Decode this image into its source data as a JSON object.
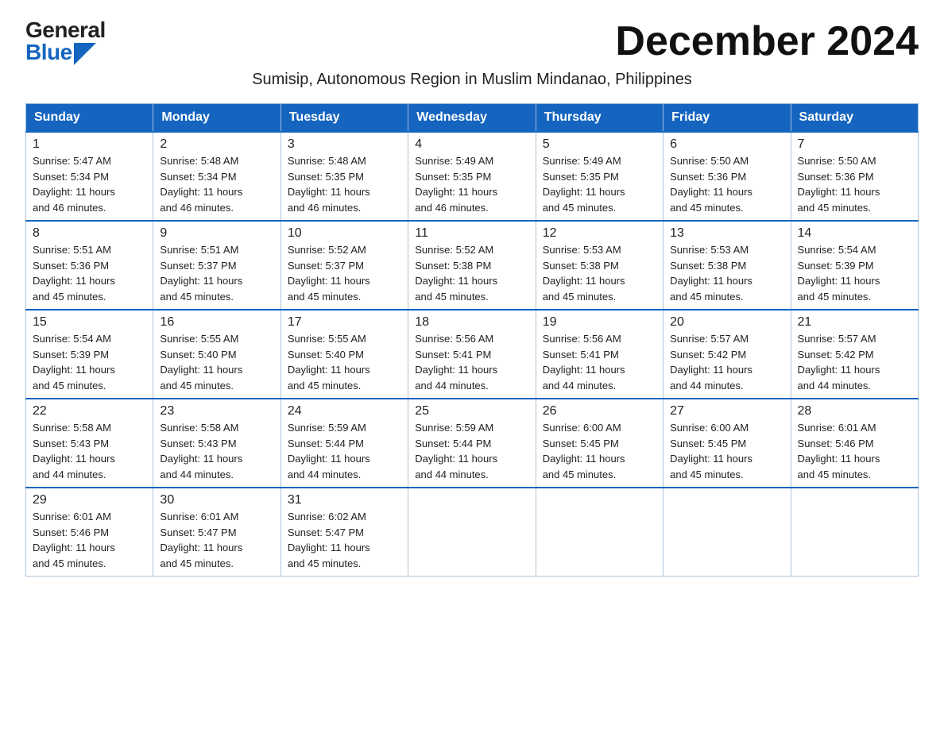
{
  "logo": {
    "general": "General",
    "blue": "Blue"
  },
  "title": "December 2024",
  "subtitle": "Sumisip, Autonomous Region in Muslim Mindanao, Philippines",
  "weekdays": [
    "Sunday",
    "Monday",
    "Tuesday",
    "Wednesday",
    "Thursday",
    "Friday",
    "Saturday"
  ],
  "weeks": [
    [
      {
        "day": "1",
        "sunrise": "5:47 AM",
        "sunset": "5:34 PM",
        "daylight": "11 hours and 46 minutes."
      },
      {
        "day": "2",
        "sunrise": "5:48 AM",
        "sunset": "5:34 PM",
        "daylight": "11 hours and 46 minutes."
      },
      {
        "day": "3",
        "sunrise": "5:48 AM",
        "sunset": "5:35 PM",
        "daylight": "11 hours and 46 minutes."
      },
      {
        "day": "4",
        "sunrise": "5:49 AM",
        "sunset": "5:35 PM",
        "daylight": "11 hours and 46 minutes."
      },
      {
        "day": "5",
        "sunrise": "5:49 AM",
        "sunset": "5:35 PM",
        "daylight": "11 hours and 45 minutes."
      },
      {
        "day": "6",
        "sunrise": "5:50 AM",
        "sunset": "5:36 PM",
        "daylight": "11 hours and 45 minutes."
      },
      {
        "day": "7",
        "sunrise": "5:50 AM",
        "sunset": "5:36 PM",
        "daylight": "11 hours and 45 minutes."
      }
    ],
    [
      {
        "day": "8",
        "sunrise": "5:51 AM",
        "sunset": "5:36 PM",
        "daylight": "11 hours and 45 minutes."
      },
      {
        "day": "9",
        "sunrise": "5:51 AM",
        "sunset": "5:37 PM",
        "daylight": "11 hours and 45 minutes."
      },
      {
        "day": "10",
        "sunrise": "5:52 AM",
        "sunset": "5:37 PM",
        "daylight": "11 hours and 45 minutes."
      },
      {
        "day": "11",
        "sunrise": "5:52 AM",
        "sunset": "5:38 PM",
        "daylight": "11 hours and 45 minutes."
      },
      {
        "day": "12",
        "sunrise": "5:53 AM",
        "sunset": "5:38 PM",
        "daylight": "11 hours and 45 minutes."
      },
      {
        "day": "13",
        "sunrise": "5:53 AM",
        "sunset": "5:38 PM",
        "daylight": "11 hours and 45 minutes."
      },
      {
        "day": "14",
        "sunrise": "5:54 AM",
        "sunset": "5:39 PM",
        "daylight": "11 hours and 45 minutes."
      }
    ],
    [
      {
        "day": "15",
        "sunrise": "5:54 AM",
        "sunset": "5:39 PM",
        "daylight": "11 hours and 45 minutes."
      },
      {
        "day": "16",
        "sunrise": "5:55 AM",
        "sunset": "5:40 PM",
        "daylight": "11 hours and 45 minutes."
      },
      {
        "day": "17",
        "sunrise": "5:55 AM",
        "sunset": "5:40 PM",
        "daylight": "11 hours and 45 minutes."
      },
      {
        "day": "18",
        "sunrise": "5:56 AM",
        "sunset": "5:41 PM",
        "daylight": "11 hours and 44 minutes."
      },
      {
        "day": "19",
        "sunrise": "5:56 AM",
        "sunset": "5:41 PM",
        "daylight": "11 hours and 44 minutes."
      },
      {
        "day": "20",
        "sunrise": "5:57 AM",
        "sunset": "5:42 PM",
        "daylight": "11 hours and 44 minutes."
      },
      {
        "day": "21",
        "sunrise": "5:57 AM",
        "sunset": "5:42 PM",
        "daylight": "11 hours and 44 minutes."
      }
    ],
    [
      {
        "day": "22",
        "sunrise": "5:58 AM",
        "sunset": "5:43 PM",
        "daylight": "11 hours and 44 minutes."
      },
      {
        "day": "23",
        "sunrise": "5:58 AM",
        "sunset": "5:43 PM",
        "daylight": "11 hours and 44 minutes."
      },
      {
        "day": "24",
        "sunrise": "5:59 AM",
        "sunset": "5:44 PM",
        "daylight": "11 hours and 44 minutes."
      },
      {
        "day": "25",
        "sunrise": "5:59 AM",
        "sunset": "5:44 PM",
        "daylight": "11 hours and 44 minutes."
      },
      {
        "day": "26",
        "sunrise": "6:00 AM",
        "sunset": "5:45 PM",
        "daylight": "11 hours and 45 minutes."
      },
      {
        "day": "27",
        "sunrise": "6:00 AM",
        "sunset": "5:45 PM",
        "daylight": "11 hours and 45 minutes."
      },
      {
        "day": "28",
        "sunrise": "6:01 AM",
        "sunset": "5:46 PM",
        "daylight": "11 hours and 45 minutes."
      }
    ],
    [
      {
        "day": "29",
        "sunrise": "6:01 AM",
        "sunset": "5:46 PM",
        "daylight": "11 hours and 45 minutes."
      },
      {
        "day": "30",
        "sunrise": "6:01 AM",
        "sunset": "5:47 PM",
        "daylight": "11 hours and 45 minutes."
      },
      {
        "day": "31",
        "sunrise": "6:02 AM",
        "sunset": "5:47 PM",
        "daylight": "11 hours and 45 minutes."
      },
      null,
      null,
      null,
      null
    ]
  ],
  "labels": {
    "sunrise": "Sunrise:",
    "sunset": "Sunset:",
    "daylight": "Daylight:"
  }
}
